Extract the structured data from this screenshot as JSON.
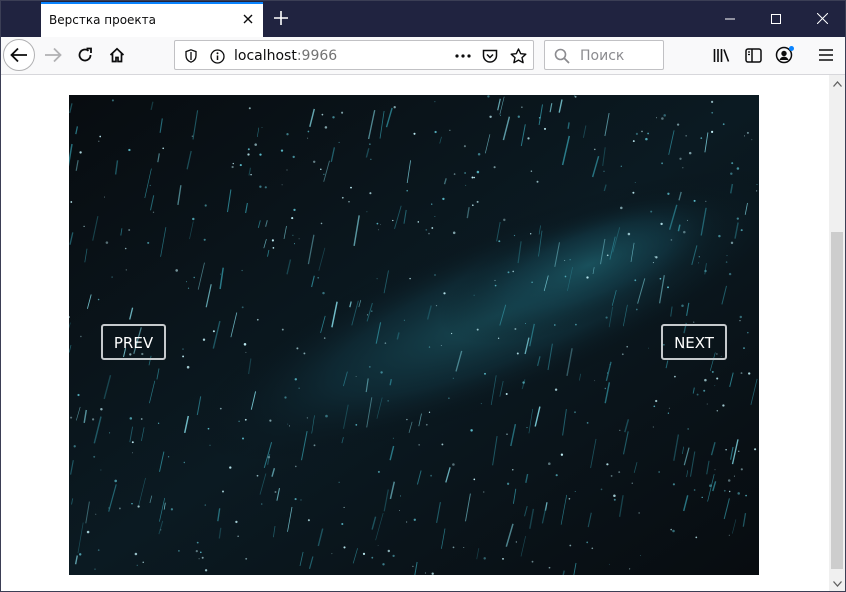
{
  "browser": {
    "tab_title": "Верстка проекта",
    "url_host": "localhost",
    "url_port": ":9966",
    "search_placeholder": "Поиск",
    "accent_color": "#0a84ff",
    "tabstrip_color": "#202340"
  },
  "icons": {
    "back": "arrow-left-icon",
    "forward": "arrow-right-icon",
    "reload": "reload-icon",
    "home": "home-icon",
    "tracking": "shield-icon",
    "info": "info-icon",
    "more": "more-dots-icon",
    "pocket": "pocket-icon",
    "bookmark": "star-icon",
    "search": "search-icon",
    "library": "library-icon",
    "sidebar": "sidebar-icon",
    "account": "account-icon",
    "menu": "hamburger-menu-icon"
  },
  "slider": {
    "prev_label": "PREV",
    "next_label": "NEXT",
    "image_description": "starry night sky with meteor streaks and milky way"
  }
}
